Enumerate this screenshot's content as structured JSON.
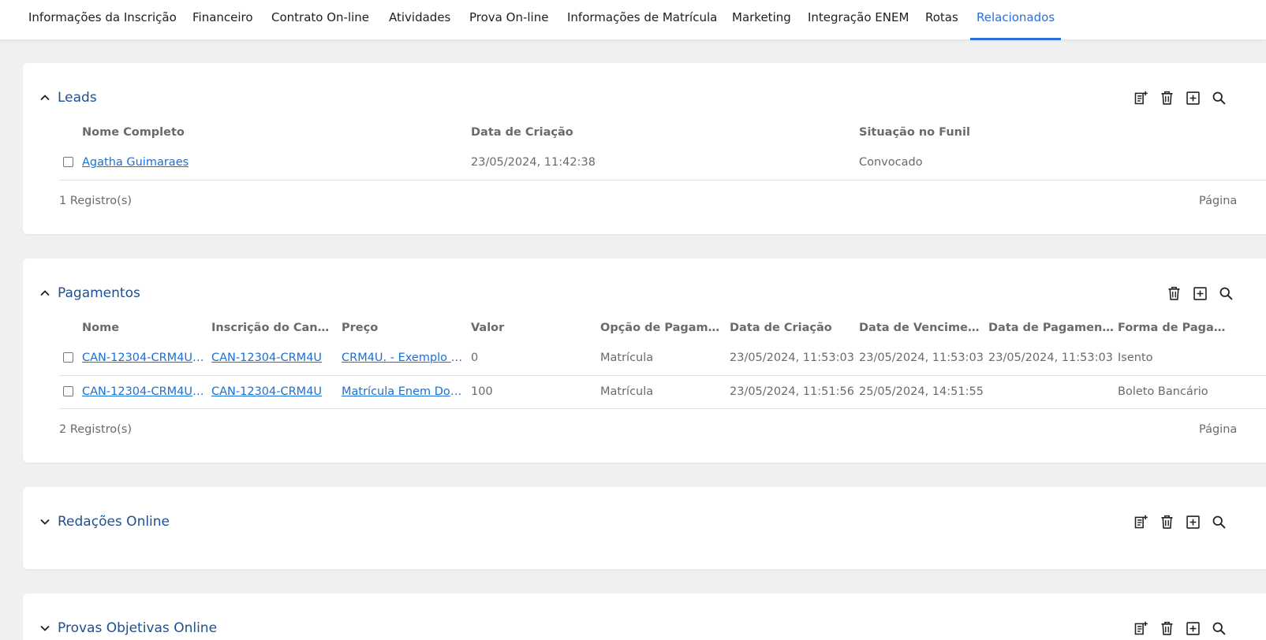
{
  "tabs": [
    {
      "label": "Informações da Inscrição"
    },
    {
      "label": "Financeiro"
    },
    {
      "label": "Contrato On-line"
    },
    {
      "label": "Atividades"
    },
    {
      "label": "Prova On-line"
    },
    {
      "label": "Informações de Matrícula"
    },
    {
      "label": "Marketing"
    },
    {
      "label": "Integração ENEM"
    },
    {
      "label": "Rotas"
    },
    {
      "label": "Relacionados"
    }
  ],
  "active_tab": "Relacionados",
  "leads": {
    "title": "Leads",
    "columns": [
      "Nome Completo",
      "Data de Criação",
      "Situação no Funil"
    ],
    "rows": [
      {
        "nome": "Agatha Guimaraes",
        "data": "23/05/2024, 11:42:38",
        "situacao": "Convocado"
      }
    ],
    "count": "1 Registro(s)",
    "pagination": "Página"
  },
  "pagamentos": {
    "title": "Pagamentos",
    "columns": [
      "Nome",
      "Inscrição do Candi...",
      "Preço",
      "Valor",
      "Opção de Pagame...",
      "Data de Criação",
      "Data de Vencimen...",
      "Data de Pagamento",
      "Forma de Pagame..."
    ],
    "rows": [
      {
        "nome": "CAN-12304-CRM4U |...",
        "inscricao": "CAN-12304-CRM4U",
        "preco": "CRM4U. - Exemplo c/...",
        "valor": "0",
        "opcao": "Matrícula",
        "criacao": "23/05/2024, 11:53:03",
        "vencimento": "23/05/2024, 11:53:03",
        "pagamento": "23/05/2024, 11:53:03",
        "forma": "Isento"
      },
      {
        "nome": "CAN-12304-CRM4U |...",
        "inscricao": "CAN-12304-CRM4U",
        "preco": "Matrícula Enem Docu...",
        "valor": "100",
        "opcao": "Matrícula",
        "criacao": "23/05/2024, 11:51:56",
        "vencimento": "25/05/2024, 14:51:55",
        "pagamento": "",
        "forma": "Boleto Bancário"
      }
    ],
    "count": "2 Registro(s)",
    "pagination": "Página"
  },
  "redacoes": {
    "title": "Redações Online"
  },
  "fourth": {
    "title": "Provas Objetivas Online"
  },
  "colors": {
    "accent": "#2b6fdc",
    "title": "#1d4f91",
    "link": "#1a6fd8",
    "background": "#eef0f2"
  },
  "icons": [
    "chevron-up-icon",
    "chevron-down-icon",
    "new-record-icon",
    "trash-icon",
    "add-box-icon",
    "search-icon"
  ]
}
